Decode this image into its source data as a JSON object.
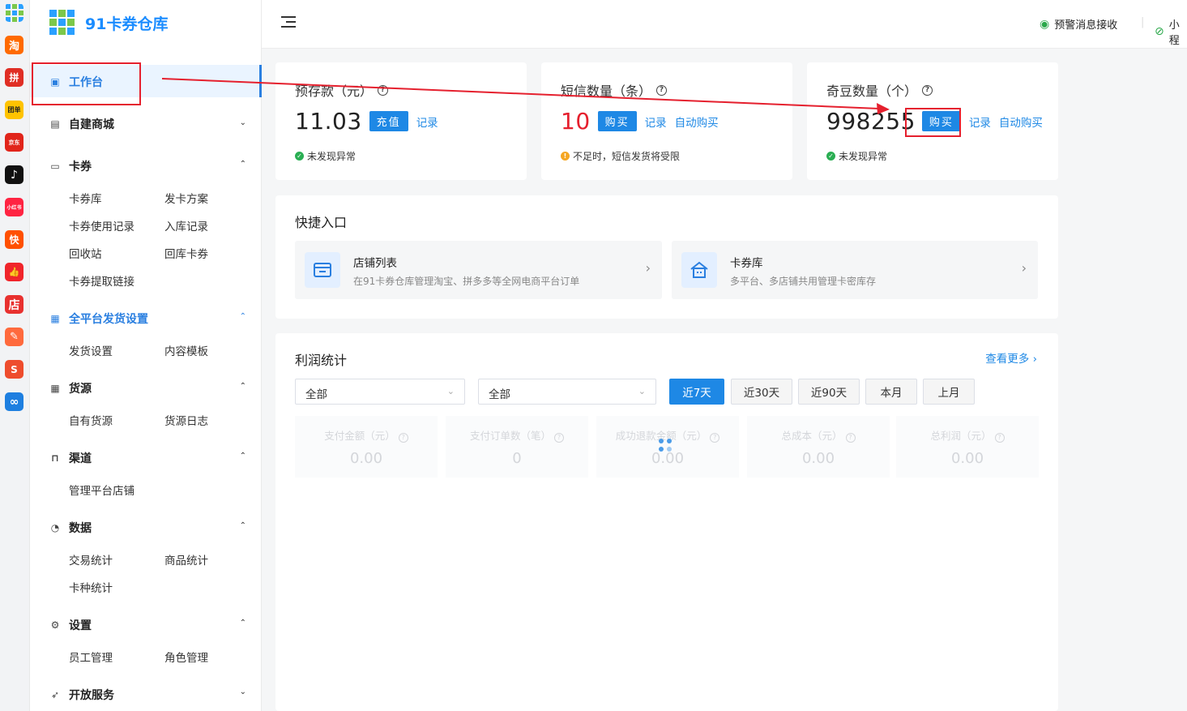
{
  "app_strip": {
    "icons": [
      {
        "name": "brand-logo-icon",
        "label": "",
        "color": ""
      },
      {
        "name": "taobao-icon",
        "label": "淘",
        "color": "#ff6a00"
      },
      {
        "name": "pinduoduo-icon",
        "label": "拼",
        "color": "#e02e24"
      },
      {
        "name": "tuan-icon",
        "label": "团单",
        "color": "#ffc300"
      },
      {
        "name": "jd-icon",
        "label": "京东",
        "color": "#e1251b"
      },
      {
        "name": "douyin-icon",
        "label": "♪",
        "color": "#111111"
      },
      {
        "name": "xiaohongshu-icon",
        "label": "小红书",
        "color": "#ff2442"
      },
      {
        "name": "kuaishou-icon",
        "label": "快",
        "color": "#ff5000"
      },
      {
        "name": "thumb-icon",
        "label": "👍",
        "color": "#f0252b"
      },
      {
        "name": "dian-icon",
        "label": "店",
        "color": "#e8312f"
      },
      {
        "name": "edit-app-icon",
        "label": "✎",
        "color": "#ff6a3d"
      },
      {
        "name": "shopee-icon",
        "label": "S",
        "color": "#ee4d2d"
      },
      {
        "name": "link-app-icon",
        "label": "∞",
        "color": "#1e7fe0"
      }
    ]
  },
  "sidebar": {
    "brand": "91卡券仓库",
    "workbench": "工作台",
    "groups": {
      "mall": "自建商城",
      "coupon": "卡券",
      "delivery": "全平台发货设置",
      "supply": "货源",
      "channel": "渠道",
      "data": "数据",
      "settings": "设置",
      "open": "开放服务"
    },
    "coupon_items": [
      "卡券库",
      "发卡方案",
      "卡券使用记录",
      "入库记录",
      "回收站",
      "回库卡券",
      "卡券提取链接"
    ],
    "delivery_items": [
      "发货设置",
      "内容模板"
    ],
    "supply_items": [
      "自有货源",
      "货源日志"
    ],
    "channel_items": [
      "管理平台店铺"
    ],
    "data_items": [
      "交易统计",
      "商品统计",
      "卡种统计"
    ],
    "settings_items": [
      "员工管理",
      "角色管理"
    ]
  },
  "topbar": {
    "alert": "预警消息接收",
    "mini": "小程"
  },
  "stats": {
    "deposit": {
      "title": "预存款（元）",
      "value": "11.03",
      "button": "充值",
      "link": "记录",
      "status": "未发现异常"
    },
    "sms": {
      "title": "短信数量（条）",
      "value": "10",
      "button": "购买",
      "link": "记录",
      "auto": "自动购买",
      "status": "不足时，短信发货将受限"
    },
    "beans": {
      "title": "奇豆数量（个）",
      "value": "998255",
      "button": "购买",
      "link": "记录",
      "auto": "自动购买",
      "status": "未发现异常"
    }
  },
  "quick": {
    "title": "快捷入口",
    "items": [
      {
        "title": "店铺列表",
        "desc": "在91卡券仓库管理淘宝、拼多多等全网电商平台订单"
      },
      {
        "title": "卡券库",
        "desc": "多平台、多店铺共用管理卡密库存"
      }
    ]
  },
  "profit": {
    "title": "利润统计",
    "more": "查看更多",
    "select1": "全部",
    "select2": "全部",
    "ranges": [
      "近7天",
      "近30天",
      "近90天",
      "本月",
      "上月"
    ],
    "active_range": "近7天",
    "metrics": [
      {
        "label": "支付金额（元）",
        "value": "0.00"
      },
      {
        "label": "支付订单数（笔）",
        "value": "0"
      },
      {
        "label": "成功退款金额（元）",
        "value": "0.00"
      },
      {
        "label": "总成本（元）",
        "value": "0.00"
      },
      {
        "label": "总利润（元）",
        "value": "0.00"
      }
    ]
  },
  "colors": {
    "accent": "#1e88e5",
    "danger": "#e5202e",
    "ok": "#2aae53",
    "warn": "#f5a623"
  }
}
